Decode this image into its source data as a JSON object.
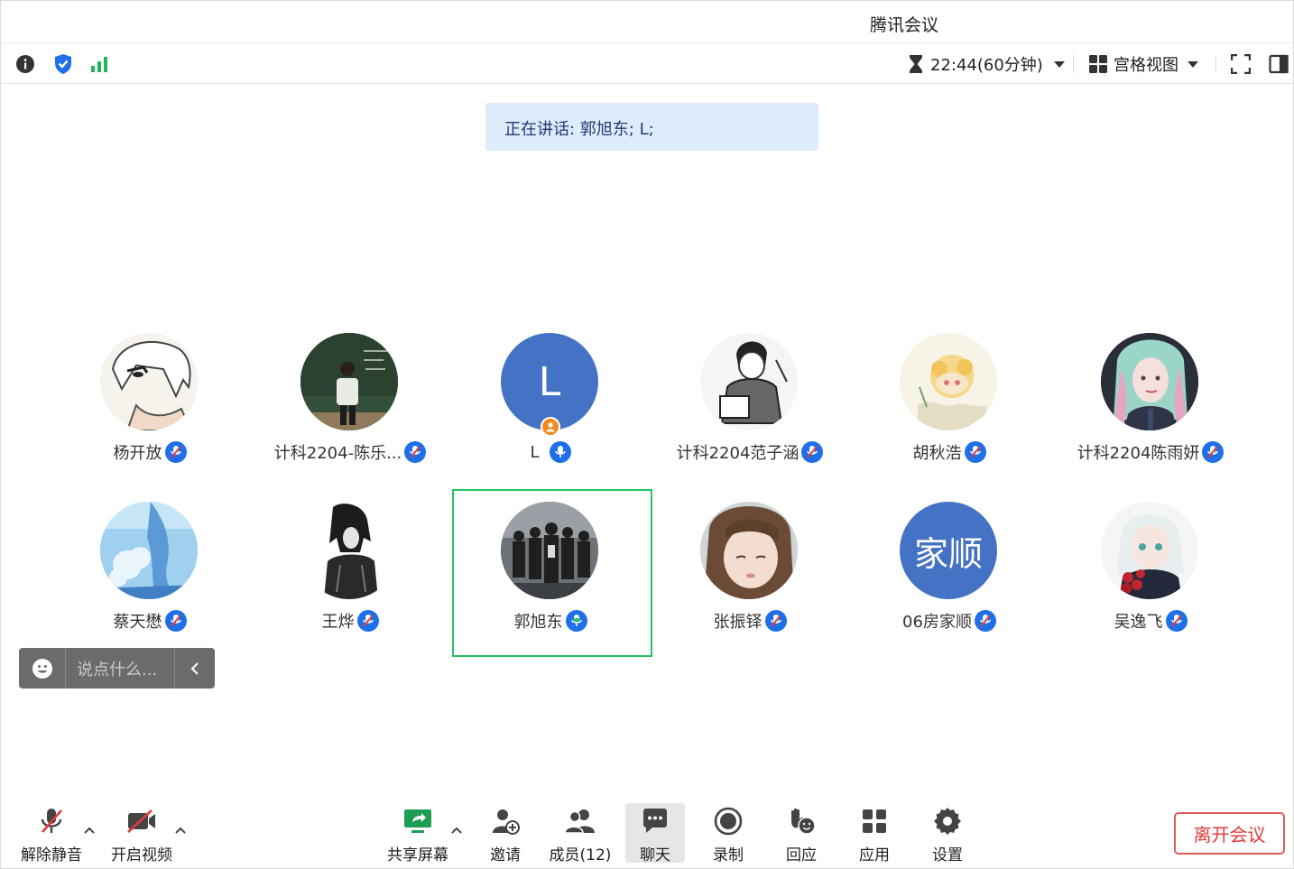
{
  "window": {
    "title": "腾讯会议"
  },
  "topbar": {
    "timer_text": "22:44(60分钟)",
    "view_label": "宫格视图"
  },
  "banner": {
    "text": "正在讲话: 郭旭东; L;"
  },
  "participants": [
    {
      "name": "杨开放",
      "mic": "muted"
    },
    {
      "name": "计科2204-陈乐...",
      "mic": "muted"
    },
    {
      "name": "L",
      "mic": "active",
      "avatar_letter": "L",
      "host": true
    },
    {
      "name": "计科2204范子涵",
      "mic": "muted"
    },
    {
      "name": "胡秋浩",
      "mic": "muted"
    },
    {
      "name": "计科2204陈雨妍",
      "mic": "muted"
    },
    {
      "name": "蔡天懋",
      "mic": "muted"
    },
    {
      "name": "王烨",
      "mic": "muted"
    },
    {
      "name": "郭旭东",
      "mic": "active",
      "speaking": true
    },
    {
      "name": "张振铎",
      "mic": "muted"
    },
    {
      "name": "06房家顺",
      "mic": "muted",
      "avatar_text": "家顺"
    },
    {
      "name": "吴逸飞",
      "mic": "muted"
    }
  ],
  "chat": {
    "placeholder": "说点什么..."
  },
  "bottombar": {
    "unmute_label": "解除静音",
    "video_label": "开启视频",
    "share_label": "共享屏幕",
    "invite_label": "邀请",
    "members_label": "成员(12)",
    "chat_label": "聊天",
    "record_label": "录制",
    "react_label": "回应",
    "apps_label": "应用",
    "settings_label": "设置",
    "leave_label": "离开会议"
  },
  "colors": {
    "accent_blue": "#1f6fe8",
    "avatar_blue": "#4472c4",
    "speaking_green": "#22c55e",
    "leave_red": "#e03a3a",
    "banner_bg": "#deebfc"
  }
}
